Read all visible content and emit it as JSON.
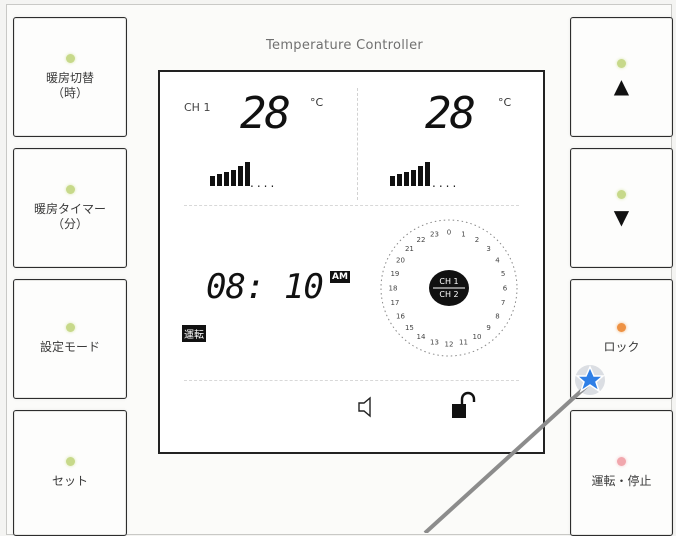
{
  "title": "Temperature Controller",
  "left_buttons": [
    {
      "label": "暖房切替\n（時）",
      "led": "green"
    },
    {
      "label": "暖房タイマー\n（分）",
      "led": "green"
    },
    {
      "label": "設定モード",
      "led": "green"
    },
    {
      "label": "セット",
      "led": "green"
    }
  ],
  "right_buttons": [
    {
      "label": "▲",
      "led": "green"
    },
    {
      "label": "▼",
      "led": "green"
    },
    {
      "label": "ロック",
      "led": "orange"
    },
    {
      "label": "運転・停止",
      "led": "pink"
    }
  ],
  "lcd": {
    "ch_label": "CH 1",
    "temp_left": "28",
    "temp_right": "28",
    "unit": "°C",
    "bar_dots": "....",
    "clock": "08: 10",
    "ampm": "AM",
    "run_tag": "運転",
    "dial_ch1": "CH 1",
    "dial_ch2": "CH 2",
    "dial_hours": [
      "0",
      "1",
      "2",
      "3",
      "4",
      "5",
      "6",
      "7",
      "8",
      "9",
      "10",
      "11",
      "12",
      "13",
      "14",
      "15",
      "16",
      "17",
      "18",
      "19",
      "20",
      "21",
      "22",
      "23"
    ]
  },
  "colors": {
    "led_green": "#c7d98a",
    "led_orange": "#ee9244",
    "led_pink": "#f1a7ad",
    "cursor": "#2f7fe6"
  },
  "icons": [
    "speaker-icon",
    "unlock-icon",
    "cursor-icon"
  ]
}
